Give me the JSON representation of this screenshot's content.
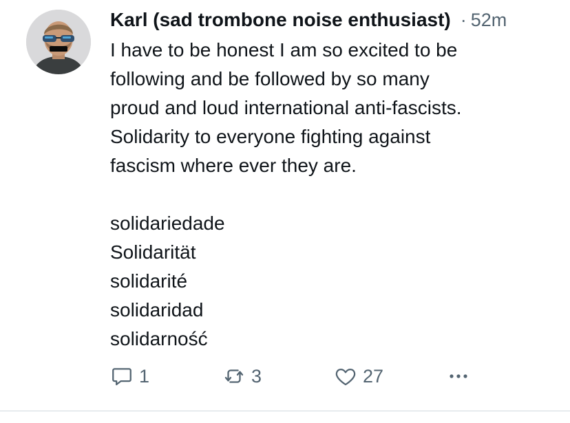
{
  "tweet": {
    "author_name": "Karl (sad trombone noise enthusiast)",
    "separator": "·",
    "timestamp": "52m",
    "body": "I have to be honest I am so excited to be\nfollowing and be followed by so many\nproud and loud international anti-fascists.\nSolidarity to everyone fighting against\nfascism where ever they are.\n\nsolidariedade\nSolidarität\nsolidarité\nsolidaridad\nsolidarność"
  },
  "actions": {
    "reply_count": "1",
    "retweet_count": "3",
    "like_count": "27"
  },
  "icons": {
    "reply": "reply-icon",
    "retweet": "retweet-icon",
    "like": "heart-icon",
    "more": "more-icon"
  },
  "colors": {
    "text": "#0f1419",
    "secondary": "#536471",
    "divider": "#cfd9de"
  }
}
